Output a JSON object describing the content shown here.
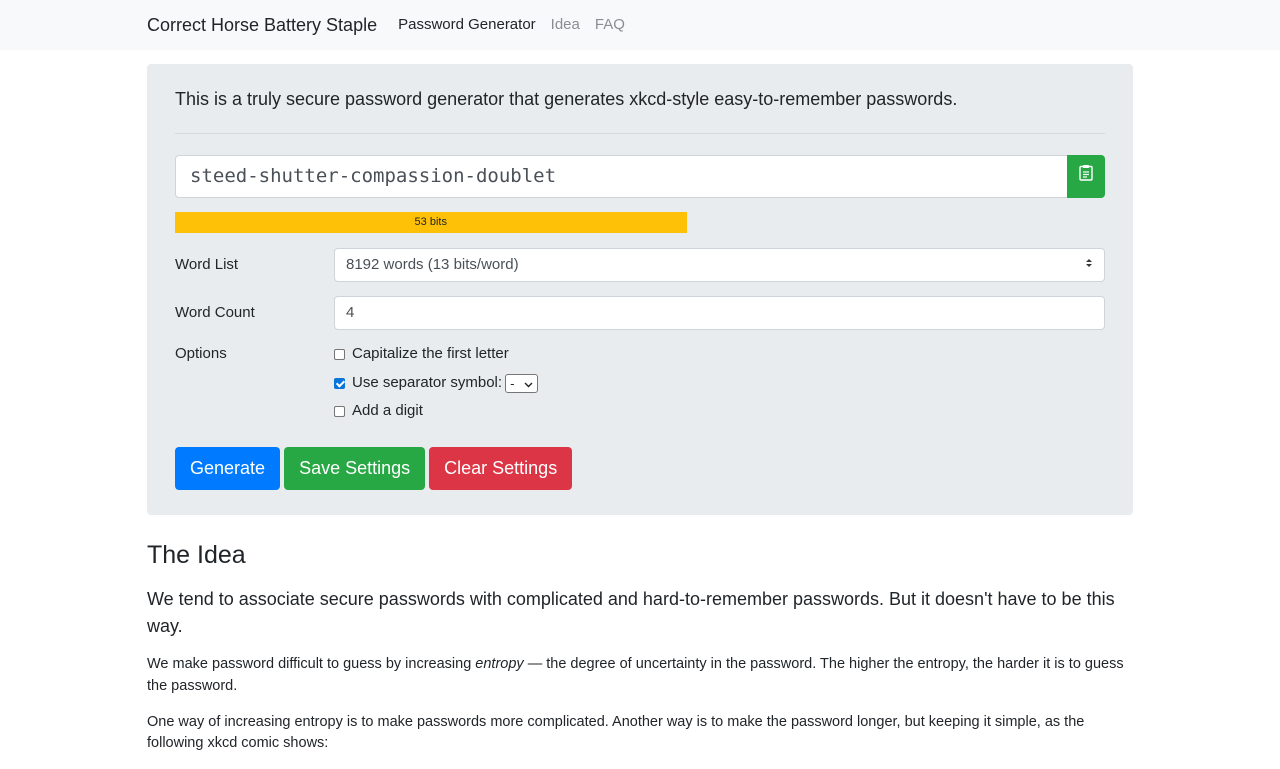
{
  "navbar": {
    "brand": "Correct Horse Battery Staple",
    "links": [
      {
        "label": "Password Generator"
      },
      {
        "label": "Idea"
      },
      {
        "label": "FAQ"
      }
    ]
  },
  "generator": {
    "intro": "This is a truly secure password generator that generates xkcd-style easy-to-remember passwords.",
    "password": "steed-shutter-compassion-doublet",
    "copy_icon": "clipboard-icon",
    "strength": {
      "label": "53 bits",
      "fraction": 0.55
    },
    "word_list": {
      "label": "Word List",
      "selected": "8192 words (13 bits/word)"
    },
    "word_count": {
      "label": "Word Count",
      "value": "4"
    },
    "options": {
      "label": "Options",
      "capitalize": {
        "label": "Capitalize the first letter",
        "checked": false
      },
      "separator": {
        "label": "Use separator symbol:",
        "checked": true,
        "symbol": "-"
      },
      "digit": {
        "label": "Add a digit",
        "checked": false
      }
    },
    "buttons": {
      "generate": "Generate",
      "save": "Save Settings",
      "clear": "Clear Settings"
    }
  },
  "idea": {
    "title": "The Idea",
    "lead": "We tend to associate secure passwords with complicated and hard-to-remember passwords. But it doesn't have to be this way.",
    "p1_before": "We make password difficult to guess by increasing ",
    "p1_em": "entropy",
    "p1_after": " — the degree of uncertainty in the password. The higher the entropy, the harder it is to guess the password.",
    "p2": "One way of increasing entropy is to make passwords more complicated. Another way is to make the password longer, but keeping it simple, as the following xkcd comic shows:"
  },
  "colors": {
    "primary": "#007bff",
    "success": "#28a745",
    "danger": "#dc3545",
    "warning": "#ffc107"
  }
}
